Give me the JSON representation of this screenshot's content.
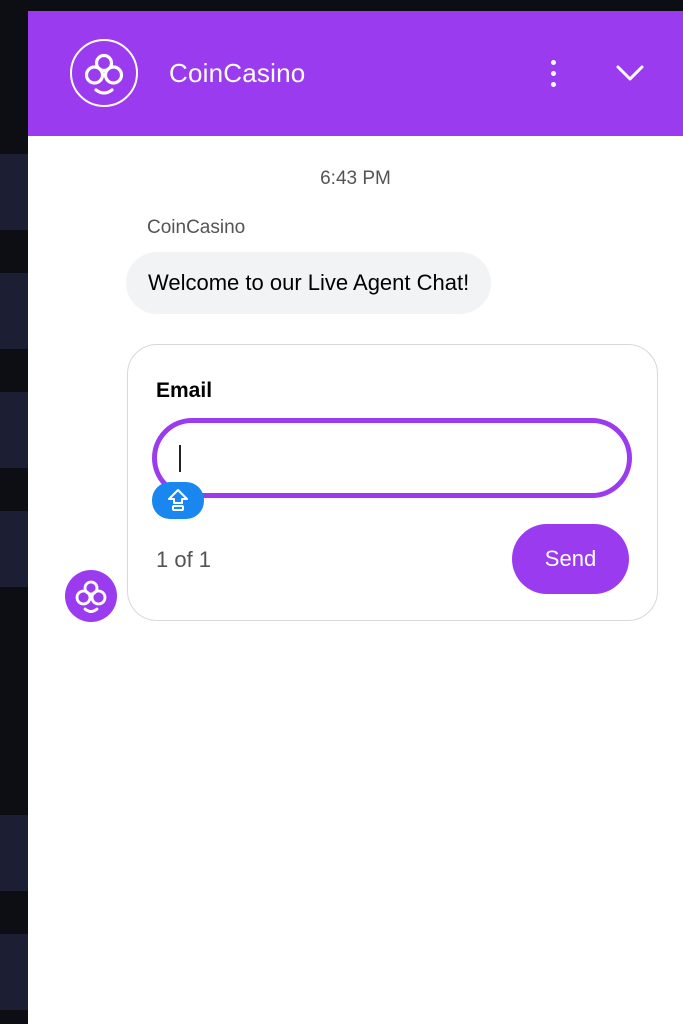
{
  "header": {
    "title": "CoinCasino",
    "logo_icon": "coincasino-logo-icon",
    "menu_icon": "kebab-menu-icon",
    "collapse_icon": "chevron-down-icon",
    "background_color": "#9b3bf0"
  },
  "conversation": {
    "timestamp": "6:43 PM",
    "sender": "CoinCasino",
    "message": "Welcome to our Live Agent Chat!"
  },
  "form": {
    "field_label": "Email",
    "field_value": "",
    "field_placeholder": "",
    "autofill_icon": "password-autofill-icon",
    "page_indicator": "1 of 1",
    "send_label": "Send"
  },
  "colors": {
    "accent": "#9b3bf0",
    "autofill": "#1a86f0",
    "bubble": "#f1f3f5"
  }
}
